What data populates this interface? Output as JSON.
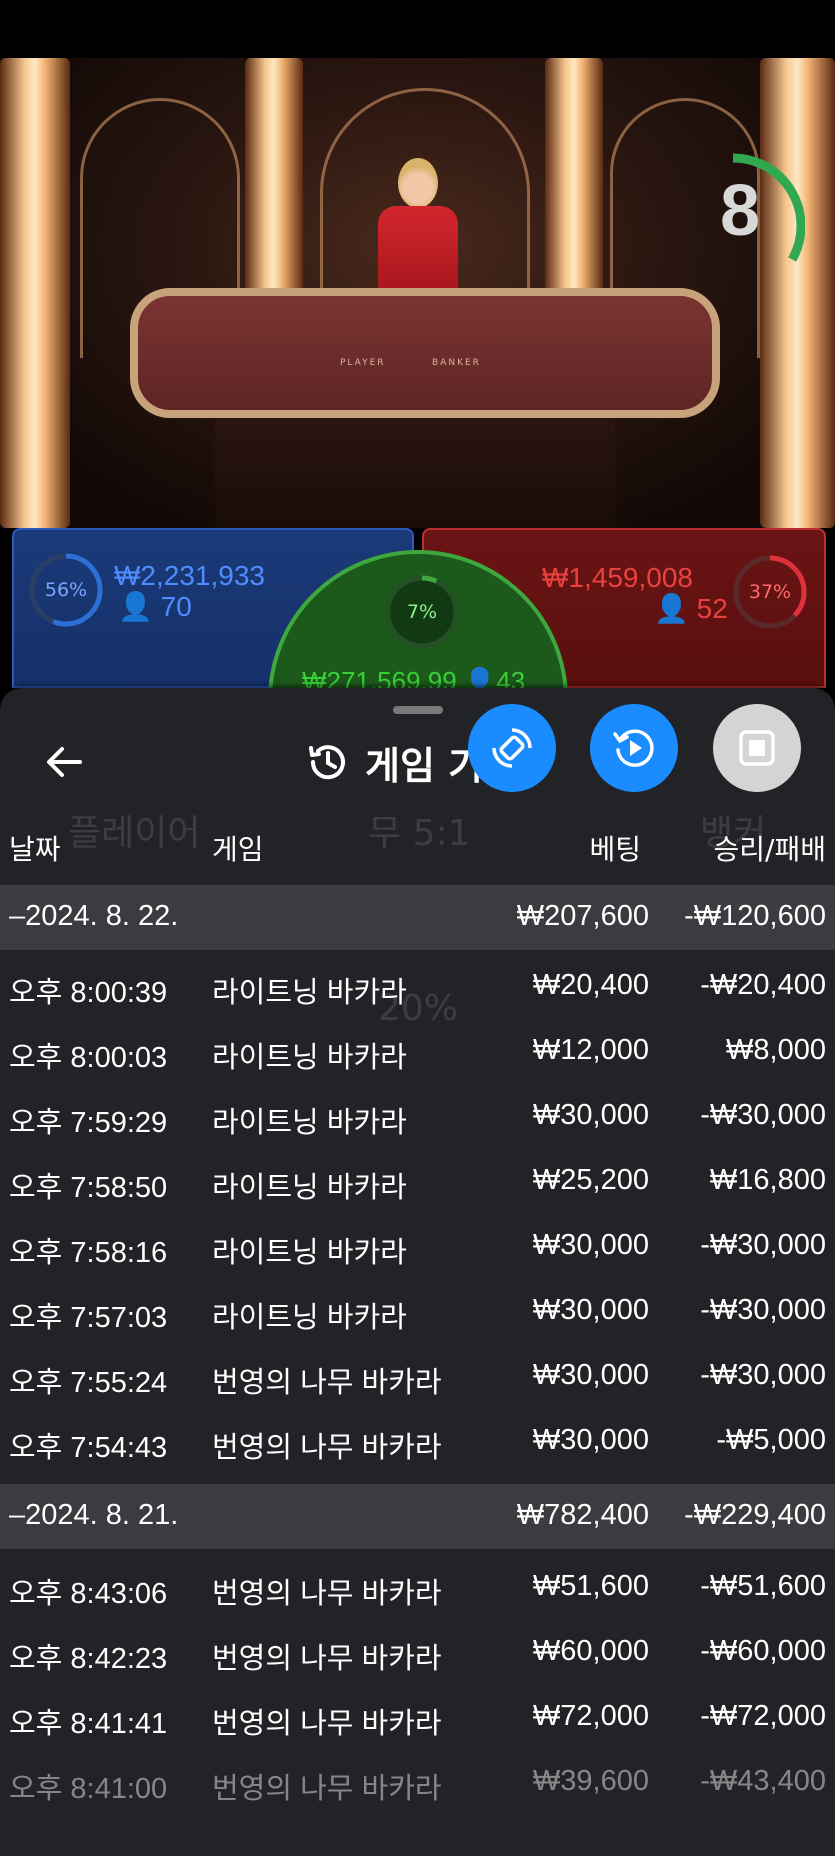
{
  "timer": {
    "value": "8",
    "progress": 0.6,
    "color": "#2fa84f"
  },
  "video": {
    "table_labels": [
      "PLAYER",
      "BANKER"
    ]
  },
  "player": {
    "percent": "56%",
    "amount": "₩2,231,933",
    "count": "70",
    "color": "#2c6fd6"
  },
  "banker": {
    "percent": "37%",
    "amount": "₩1,459,008",
    "count": "52",
    "color": "#e0303a"
  },
  "tie": {
    "percent": "7%",
    "amount": "₩271,569.99",
    "count": "43",
    "color": "#3ea83e"
  },
  "background_hint": {
    "player": "플레이어",
    "tie": "무 5:1",
    "banker": "뱅커",
    "mid": "20%"
  },
  "sheet": {
    "title": "게임 기",
    "back_icon": "arrow-left-icon",
    "history_icon": "history-icon",
    "buttons": [
      {
        "name": "rotate-screen-button",
        "icon": "rotate-icon",
        "color": "#1a8cff"
      },
      {
        "name": "replay-button",
        "icon": "replay-icon",
        "color": "#1a8cff"
      },
      {
        "name": "stop-button",
        "icon": "stop-icon",
        "color": "#d4d4d4"
      }
    ],
    "columns": {
      "date": "날짜",
      "game": "게임",
      "bet": "베팅",
      "result": "승리/패배"
    },
    "groups": [
      {
        "date": "–2024. 8. 22.",
        "bet_total": "₩207,600",
        "result_total": "-₩120,600",
        "rows": [
          {
            "time": "오후 8:00:39",
            "game": "라이트닝 바카라",
            "bet": "₩20,400",
            "result": "-₩20,400"
          },
          {
            "time": "오후 8:00:03",
            "game": "라이트닝 바카라",
            "bet": "₩12,000",
            "result": "₩8,000"
          },
          {
            "time": "오후 7:59:29",
            "game": "라이트닝 바카라",
            "bet": "₩30,000",
            "result": "-₩30,000"
          },
          {
            "time": "오후 7:58:50",
            "game": "라이트닝 바카라",
            "bet": "₩25,200",
            "result": "₩16,800"
          },
          {
            "time": "오후 7:58:16",
            "game": "라이트닝 바카라",
            "bet": "₩30,000",
            "result": "-₩30,000"
          },
          {
            "time": "오후 7:57:03",
            "game": "라이트닝 바카라",
            "bet": "₩30,000",
            "result": "-₩30,000"
          },
          {
            "time": "오후 7:55:24",
            "game": "번영의 나무 바카라",
            "bet": "₩30,000",
            "result": "-₩30,000"
          },
          {
            "time": "오후 7:54:43",
            "game": "번영의 나무 바카라",
            "bet": "₩30,000",
            "result": "-₩5,000"
          }
        ]
      },
      {
        "date": "–2024. 8. 21.",
        "bet_total": "₩782,400",
        "result_total": "-₩229,400",
        "rows": [
          {
            "time": "오후 8:43:06",
            "game": "번영의 나무 바카라",
            "bet": "₩51,600",
            "result": "-₩51,600"
          },
          {
            "time": "오후 8:42:23",
            "game": "번영의 나무 바카라",
            "bet": "₩60,000",
            "result": "-₩60,000"
          },
          {
            "time": "오후 8:41:41",
            "game": "번영의 나무 바카라",
            "bet": "₩72,000",
            "result": "-₩72,000"
          },
          {
            "time": "오후 8:41:00",
            "game": "번영의 나무 바카라",
            "bet": "₩39,600",
            "result": "-₩43,400"
          }
        ]
      }
    ]
  }
}
